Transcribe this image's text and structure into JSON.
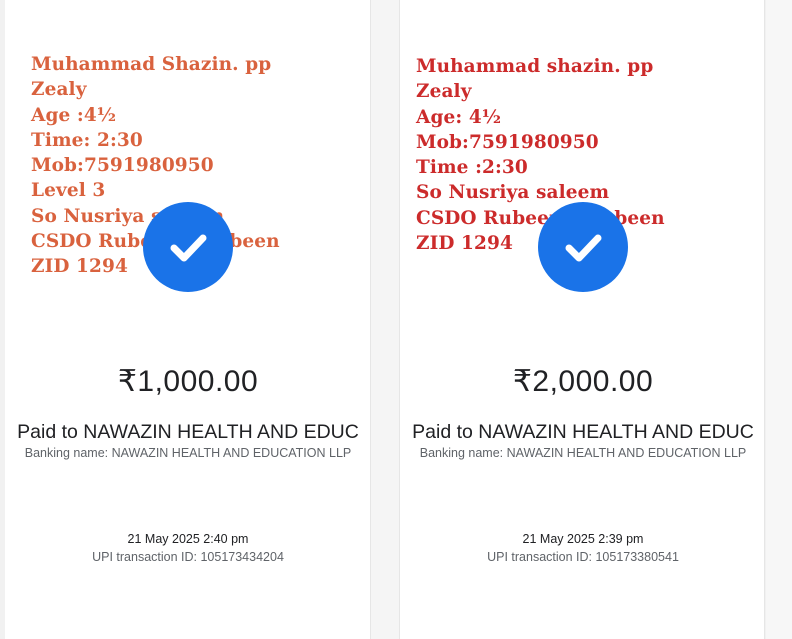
{
  "colors": {
    "check_blue": "#1a73e8",
    "note1_color": "#d9623e",
    "note2_color": "#cc2b2b"
  },
  "cards": [
    {
      "note_lines": [
        "Muhammad Shazin. pp",
        "Zealy",
        "Age :4½",
        "Time: 2:30",
        "Mob:7591980950",
        "Level 3",
        "So Nusriya saleem",
        "CSDO Rubeena mubeen",
        "ZID 1294"
      ],
      "status_icon": "check-circle-icon",
      "amount": "₹1,000.00",
      "paid_to": "Paid to NAWAZIN HEALTH AND EDUC",
      "banking_name": "Banking name: NAWAZIN HEALTH AND EDUCATION LLP",
      "datetime": "21 May 2025 2:40 pm",
      "upi_txn": "UPI transaction ID: 105173434204"
    },
    {
      "note_lines": [
        "Muhammad shazin. pp",
        "Zealy",
        "Age: 4½",
        "Mob:7591980950",
        "Time :2:30",
        "So Nusriya saleem",
        "CSDO Rubeena mubeen",
        "ZID 1294"
      ],
      "status_icon": "check-circle-icon",
      "amount": "₹2,000.00",
      "paid_to": "Paid to NAWAZIN HEALTH AND EDUC",
      "banking_name": "Banking name: NAWAZIN HEALTH AND EDUCATION LLP",
      "datetime": "21 May 2025 2:39 pm",
      "upi_txn": "UPI transaction ID: 105173380541"
    }
  ]
}
